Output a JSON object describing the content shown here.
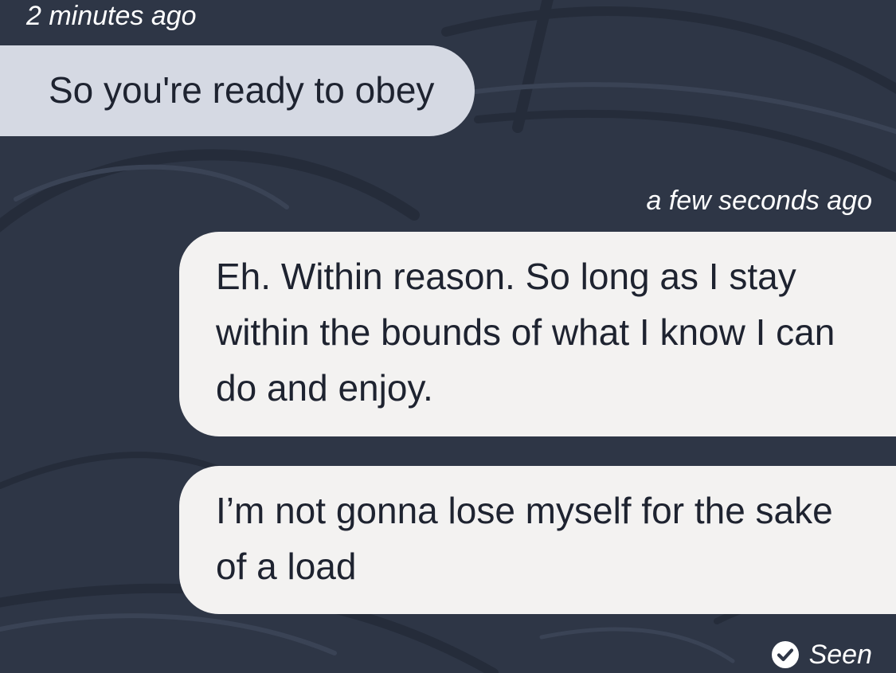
{
  "colors": {
    "background": "#2e3646",
    "incoming_bubble": "#d5d9e3",
    "outgoing_bubble": "#f3f2f1",
    "bubble_text": "#1e2330",
    "meta_text": "#ffffff"
  },
  "conversation": {
    "incoming": {
      "timestamp": "2 minutes ago",
      "message": "So you're ready to obey"
    },
    "outgoing": {
      "timestamp": "a few seconds ago",
      "messages": [
        "Eh. Within reason. So long as I stay within the bounds of what I know I can do and enjoy.",
        "I’m not gonna lose myself for the sake of a load"
      ]
    },
    "read_receipt": {
      "icon": "check-circle-icon",
      "label": "Seen"
    }
  }
}
